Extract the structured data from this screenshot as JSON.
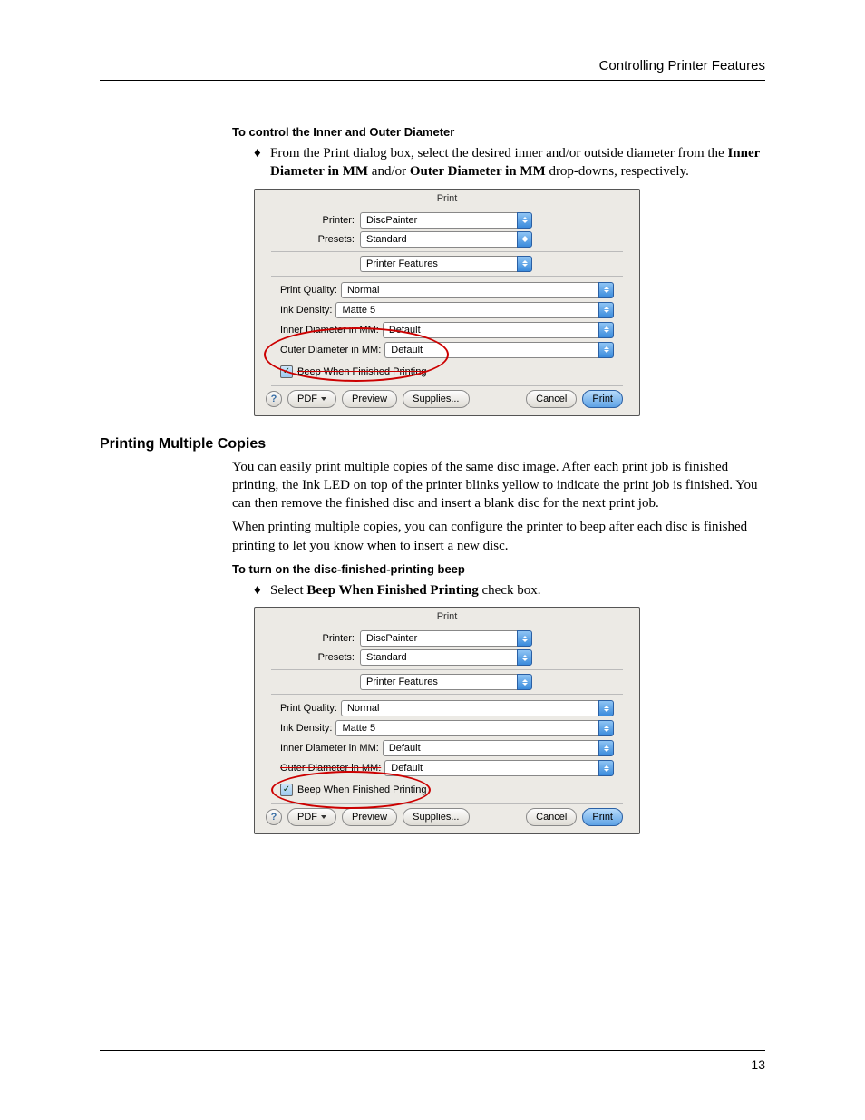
{
  "header": {
    "right": "Controlling Printer Features"
  },
  "footer": {
    "page": "13"
  },
  "section1": {
    "heading": "To control the Inner and Outer Diameter",
    "bullet_pre": "From the Print dialog box, select the desired inner and/or outside diameter from the ",
    "bullet_b1": "Inner Diameter in MM",
    "bullet_mid": " and/or ",
    "bullet_b2": "Outer Diameter in MM",
    "bullet_post": " drop-downs, respectively."
  },
  "section2": {
    "title": "Printing Multiple Copies",
    "p1": "You can easily print multiple copies of the same disc image. After each print job is finished printing, the Ink LED on top of the printer blinks yellow to indicate the print job is finished. You can then remove the finished disc and insert a blank disc for the next print job.",
    "p2": "When printing multiple copies, you can configure the printer to beep after each disc is finished printing to let you know when to insert a new disc.",
    "heading2": "To turn on the disc-finished-printing beep",
    "bullet_pre": "Select ",
    "bullet_b": "Beep When Finished Printing",
    "bullet_post": " check box."
  },
  "dialog": {
    "title": "Print",
    "printer_label": "Printer:",
    "printer_value": "DiscPainter",
    "presets_label": "Presets:",
    "presets_value": "Standard",
    "pane_value": "Printer Features",
    "pq_label": "Print Quality:",
    "pq_value": "Normal",
    "id_label": "Ink Density:",
    "id_value": "Matte 5",
    "inner_label": "Inner Diameter in MM:",
    "inner_value": "Default",
    "outer_label": "Outer Diameter in MM:",
    "outer_value": "Default",
    "beep_label": "Beep When Finished Printing",
    "help": "?",
    "pdf": "PDF",
    "preview": "Preview",
    "supplies": "Supplies...",
    "cancel": "Cancel",
    "print": "Print"
  },
  "chart_data": null
}
